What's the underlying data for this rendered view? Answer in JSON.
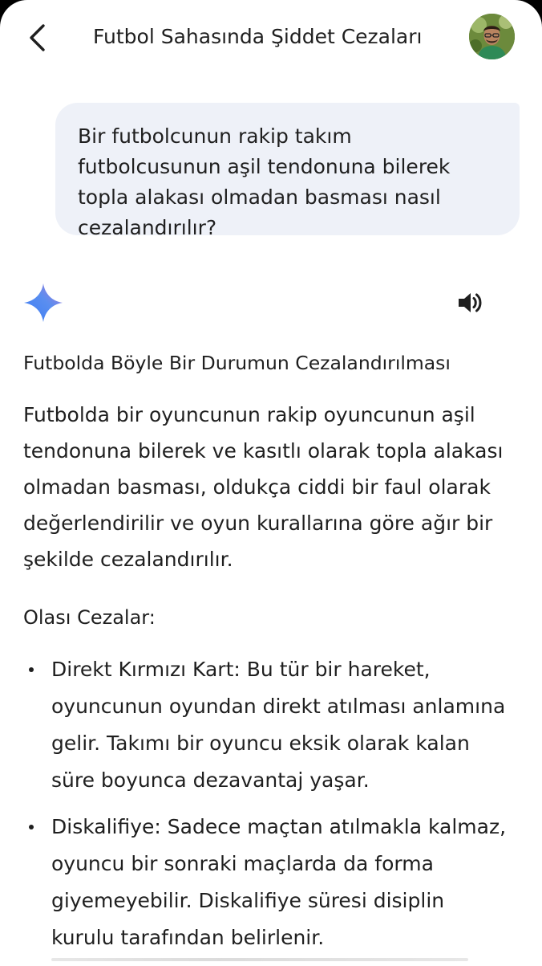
{
  "header": {
    "title": "Futbol Sahasında Şiddet Cezaları"
  },
  "conversation": {
    "user_message": "Bir futbolcunun rakip takım futbolcusunun aşil tendonuna bilerek topla alakası olmadan basması nasıl cezalandırılır?",
    "response": {
      "heading": "Futbolda Böyle Bir Durumun Cezalandırılması",
      "paragraph": "Futbolda bir oyuncunun rakip oyuncunun aşil tendonuna bilerek ve kasıtlı olarak topla alakası olmadan basması, oldukça ciddi bir faul olarak değerlendirilir ve oyun kurallarına göre ağır bir şekilde cezalandırılır.",
      "section_label": "Olası Cezalar:",
      "bullets": [
        "Direkt Kırmızı Kart: Bu tür bir hareket, oyuncunun oyundan direkt atılması anlamına gelir. Takımı bir oyuncu eksik olarak kalan süre boyunca dezavantaj yaşar.",
        "Diskalifiye: Sadece maçtan atılmakla kalmaz, oyuncu bir sonraki maçlarda da forma giyemeyebilir. Diskalifiye süresi disiplin kurulu tarafından belirlenir."
      ]
    }
  },
  "icons": {
    "back": "arrow-back-icon",
    "spark": "gemini-spark-icon",
    "speaker": "speaker-icon",
    "avatar": "user-avatar"
  },
  "colors": {
    "bubble": "#eef1f8",
    "text": "#1f1f1f",
    "spark_blue": "#4285f4",
    "spark_purple": "#9b72cb"
  }
}
